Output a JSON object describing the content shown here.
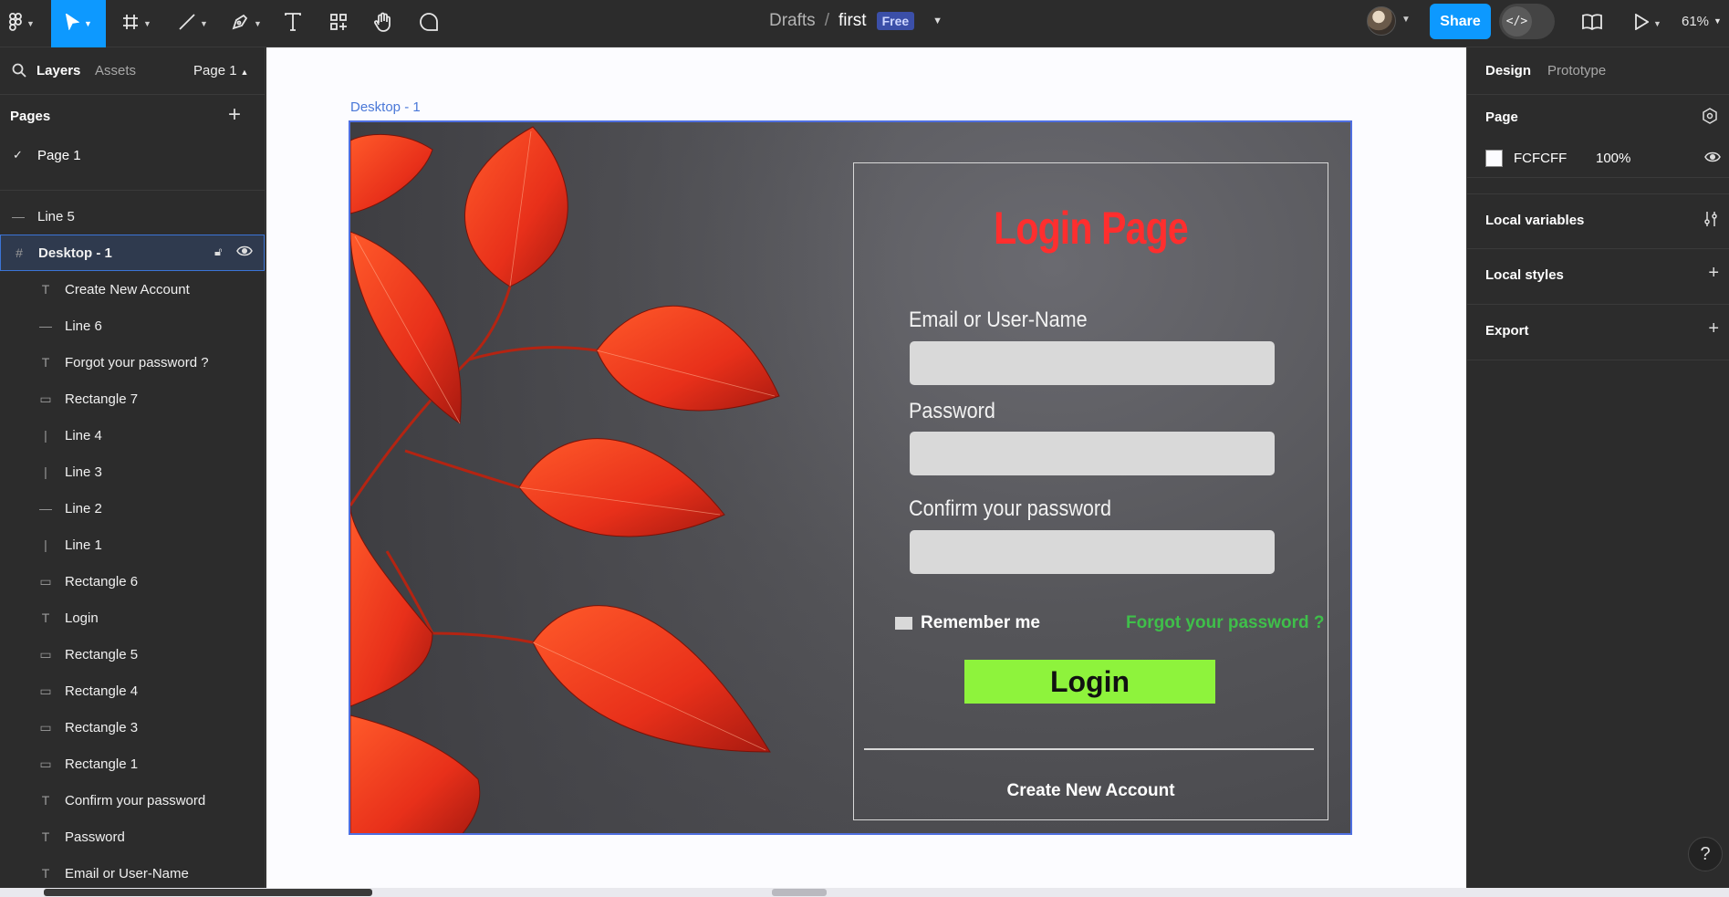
{
  "toolbar": {
    "breadcrumb_drafts": "Drafts",
    "breadcrumb_sep": "/",
    "file_name": "first",
    "plan_badge": "Free",
    "share_label": "Share",
    "dev_mode_glyph": "</>",
    "zoom_level": "61%",
    "tools": [
      "main-menu-icon",
      "move-tool-icon",
      "frame-tool-icon",
      "line-tool-icon",
      "pen-tool-icon",
      "text-tool-icon",
      "components-icon",
      "hand-tool-icon",
      "comment-icon"
    ],
    "accent_color": "#0d99ff"
  },
  "left_panel": {
    "tab_layers": "Layers",
    "tab_assets": "Assets",
    "page_selector": "Page 1",
    "pages_heading": "Pages",
    "pages": [
      "Page 1"
    ],
    "top_layers": [
      {
        "name": "Line 5",
        "icon": "line-icon"
      },
      {
        "name": "Desktop - 1",
        "icon": "frame-icon"
      }
    ],
    "child_layers": [
      {
        "name": "Create New Account",
        "icon": "text-icon"
      },
      {
        "name": "Line 6",
        "icon": "line-icon"
      },
      {
        "name": "Forgot your password ?",
        "icon": "text-icon"
      },
      {
        "name": "Rectangle 7",
        "icon": "rectangle-icon"
      },
      {
        "name": "Line 4",
        "icon": "vertical-line-icon"
      },
      {
        "name": "Line 3",
        "icon": "vertical-line-icon"
      },
      {
        "name": "Line 2",
        "icon": "line-icon"
      },
      {
        "name": "Line 1",
        "icon": "vertical-line-icon"
      },
      {
        "name": "Rectangle 6",
        "icon": "rectangle-icon"
      },
      {
        "name": "Login",
        "icon": "text-icon"
      },
      {
        "name": "Rectangle 5",
        "icon": "rectangle-icon"
      },
      {
        "name": "Rectangle 4",
        "icon": "rectangle-icon"
      },
      {
        "name": "Rectangle 3",
        "icon": "rectangle-icon"
      },
      {
        "name": "Rectangle 1",
        "icon": "rectangle-icon"
      },
      {
        "name": "Confirm your password",
        "icon": "text-icon"
      },
      {
        "name": "Password",
        "icon": "text-icon"
      },
      {
        "name": "Email or User-Name",
        "icon": "text-icon"
      }
    ]
  },
  "canvas": {
    "frame_label": "Desktop - 1",
    "background_color": "#fcfcff",
    "login": {
      "title": "Login Page",
      "email_label": "Email or User-Name",
      "password_label": "Password",
      "confirm_label": "Confirm your password",
      "remember_label": "Remember me",
      "forgot_label": "Forgot your password ?",
      "login_button": "Login",
      "create_account": "Create New Account",
      "title_color": "#ff2e2e",
      "forgot_color": "#3fbf4a",
      "button_color": "#8ef33c"
    }
  },
  "right_panel": {
    "tab_design": "Design",
    "tab_prototype": "Prototype",
    "page_heading": "Page",
    "page_color_hex": "FCFCFF",
    "page_opacity": "100%",
    "local_variables": "Local variables",
    "local_styles": "Local styles",
    "export": "Export"
  },
  "help_label": "?"
}
